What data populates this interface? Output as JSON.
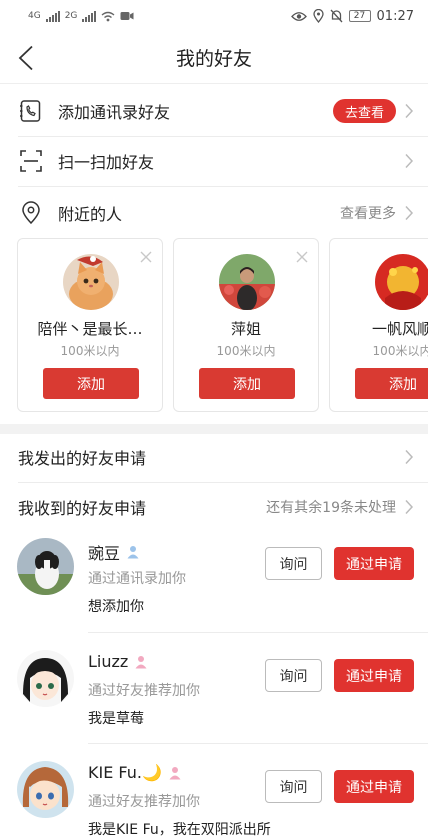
{
  "status_bar": {
    "signal1": "4G",
    "signal2": "2G",
    "battery": "27",
    "time": "01:27"
  },
  "nav": {
    "title": "我的好友"
  },
  "menu": {
    "contacts": {
      "label": "添加通讯录好友",
      "action": "去查看"
    },
    "scan": {
      "label": "扫一扫加好友"
    },
    "nearby": {
      "label": "附近的人",
      "more": "查看更多"
    }
  },
  "nearby_people": [
    {
      "name": "陪伴丶是最长…",
      "distance": "100米以内",
      "add": "添加"
    },
    {
      "name": "萍姐",
      "distance": "100米以内",
      "add": "添加"
    },
    {
      "name": "一帆风顺",
      "distance": "100米以内",
      "add": "添加"
    }
  ],
  "sent_requests": {
    "label": "我发出的好友申请"
  },
  "received_requests": {
    "label": "我收到的好友申请",
    "pending": "还有其余19条未处理"
  },
  "requests": [
    {
      "name": "豌豆",
      "via": "通过通讯录加你",
      "message": "想添加你",
      "ask": "询问",
      "accept": "通过申请",
      "gender_color": "#9cc3ea"
    },
    {
      "name": "Liuzz",
      "via": "通过好友推荐加你",
      "message": "我是草莓",
      "ask": "询问",
      "accept": "通过申请",
      "gender_color": "#f2a9c0"
    },
    {
      "name": "KIE Fu.🌙",
      "via": "通过好友推荐加你",
      "message": "我是KIE Fu，我在双阳派出所",
      "ask": "询问",
      "accept": "通过申请",
      "gender_color": "#f2a9c0"
    }
  ],
  "colors": {
    "accent": "#e0332f",
    "divider": "#ececec"
  }
}
